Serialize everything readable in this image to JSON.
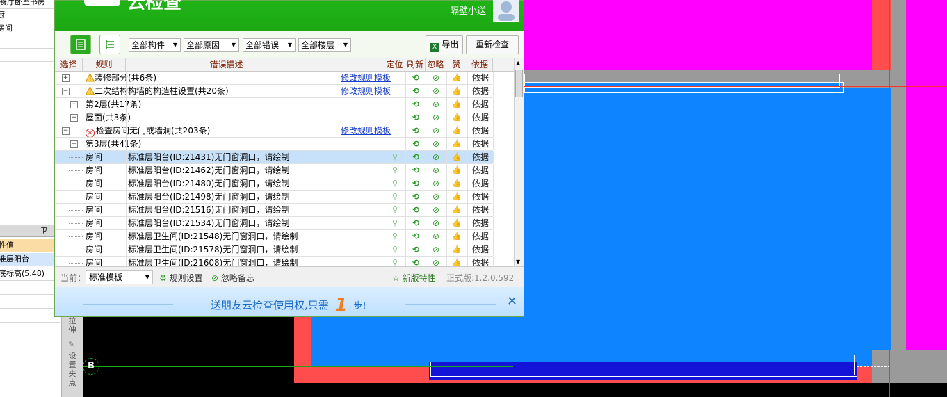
{
  "left_panel": {
    "top_items": [
      "餐厅卧室书房",
      "厨",
      "房间"
    ],
    "pin_glyph": "ㄗ",
    "prop_rows": [
      "性值",
      "准层阳台",
      "底标高(5.48)"
    ]
  },
  "vertical_toolbar": {
    "labels": [
      "拉伸",
      "设置夹点"
    ]
  },
  "cad": {
    "grid_marker": "B"
  },
  "dialog": {
    "title": "云检查",
    "username": "隔壁小送",
    "toolbar": {
      "filters": [
        "全部构件",
        "全部原因",
        "全部错误",
        "全部楼层"
      ],
      "export_label": "导出",
      "recheck_label": "重新检查"
    },
    "columns": {
      "select": "选择",
      "rule": "规则",
      "desc": "错误描述",
      "locate": "定位",
      "refresh": "刷新",
      "ignore": "忽略",
      "like": "赞",
      "basis": "依据"
    },
    "basis_label": "依据",
    "groups": [
      {
        "expander": "+",
        "type": "warn",
        "title": "装修部分(共6条)",
        "link": "修改规则模板"
      },
      {
        "expander": "−",
        "type": "warn",
        "title": "二次结构构墙的构造柱设置(共20条)",
        "link": "修改规则模板"
      },
      {
        "expander": "+",
        "type": "sub",
        "title": "第2层(共17条)",
        "link": ""
      },
      {
        "expander": "+",
        "type": "sub",
        "title": "屋面(共3条)",
        "link": ""
      },
      {
        "expander": "−",
        "type": "err",
        "title": "检查房间无门或墙洞(共203条)",
        "link": "修改规则模板"
      },
      {
        "expander": "−",
        "type": "sub",
        "title": "第3层(共41条)",
        "link": ""
      }
    ],
    "items": [
      {
        "rule": "房间",
        "desc": "标准层阳台(ID:21431)无门窗洞口，请绘制",
        "selected": true
      },
      {
        "rule": "房间",
        "desc": "标准层阳台(ID:21462)无门窗洞口，请绘制",
        "selected": false
      },
      {
        "rule": "房间",
        "desc": "标准层阳台(ID:21480)无门窗洞口，请绘制",
        "selected": false
      },
      {
        "rule": "房间",
        "desc": "标准层阳台(ID:21498)无门窗洞口，请绘制",
        "selected": false
      },
      {
        "rule": "房间",
        "desc": "标准层阳台(ID:21516)无门窗洞口，请绘制",
        "selected": false
      },
      {
        "rule": "房间",
        "desc": "标准层阳台(ID:21534)无门窗洞口，请绘制",
        "selected": false
      },
      {
        "rule": "房间",
        "desc": "标准层卫生间(ID:21548)无门窗洞口，请绘制",
        "selected": false
      },
      {
        "rule": "房间",
        "desc": "标准层卫生间(ID:21578)无门窗洞口，请绘制",
        "selected": false
      },
      {
        "rule": "房间",
        "desc": "标准层卫生间(ID:21608)无门窗洞口，请绘制",
        "selected": false
      }
    ],
    "status": {
      "current_label": "当前：",
      "template_value": "标准模板",
      "rule_settings": "规则设置",
      "ignore_notes": "忽略备忘",
      "new_features": "新版特性",
      "version": "正式版:1.2.0.592"
    },
    "banner": {
      "text_before": "送朋友云检查使用权,只需",
      "number": "1",
      "text_after": "步!"
    }
  },
  "colors": {
    "title_green": "#1fb416",
    "cad_magenta": "#ff00ff",
    "cad_blue": "#0f84ff",
    "cad_red": "#ff4c4c",
    "cad_gray": "#9a9a9a",
    "selected_row": "#c7e1fa",
    "link_blue": "#1a3fc8",
    "banner_orange": "#f07e1e"
  }
}
